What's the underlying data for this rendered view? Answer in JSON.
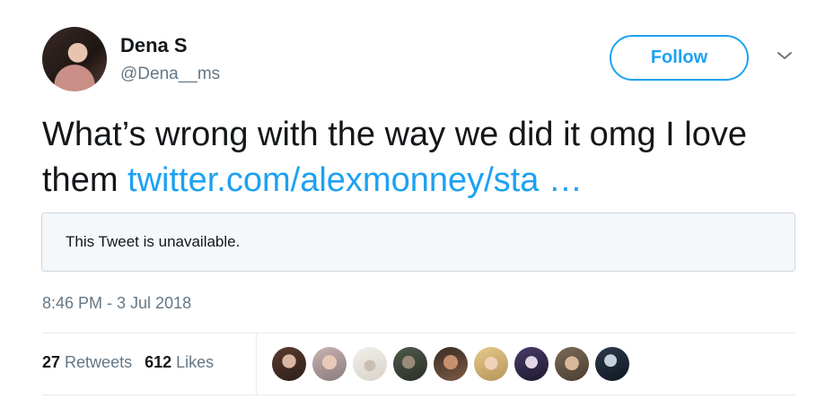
{
  "user": {
    "name": "Dena S",
    "handle": "@Dena__ms"
  },
  "follow_label": "Follow",
  "tweet": {
    "text": "What’s wrong with the way we did it omg I love them ",
    "link": "twitter.com/alexmonney/sta …"
  },
  "quote": {
    "text": "This Tweet is unavailable."
  },
  "timestamp": "8:46 PM - 3 Jul 2018",
  "stats": {
    "retweets_count": "27",
    "retweets_label": "Retweets",
    "likes_count": "612",
    "likes_label": "Likes"
  },
  "icons": {
    "more": "chevron-down-icon"
  },
  "colors": {
    "accent": "#1da1f2",
    "muted": "#657786",
    "text": "#14171a",
    "border": "#e6ecf0"
  }
}
